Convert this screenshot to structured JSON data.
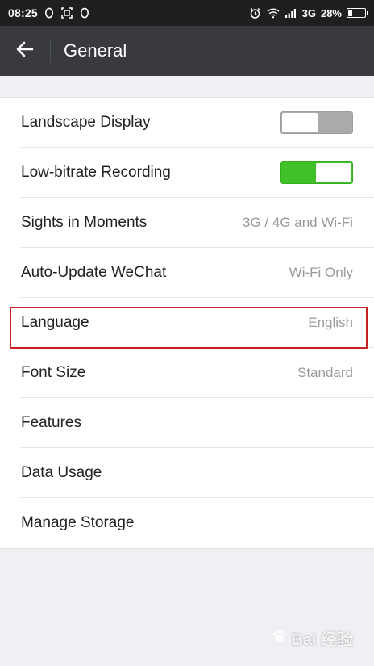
{
  "status_bar": {
    "time": "08:25",
    "network": "3G",
    "battery": "28%",
    "battery_level": 0.28,
    "left_icons": [
      "qq-penguin-icon",
      "screenshot-icon",
      "qq-penguin-icon"
    ],
    "right_icons": [
      "alarm-icon",
      "wifi-icon",
      "signal-icon"
    ]
  },
  "app_bar": {
    "title": "General",
    "back_icon": "back-arrow-icon"
  },
  "settings": {
    "items": [
      {
        "label": "Landscape Display",
        "type": "toggle",
        "on": false
      },
      {
        "label": "Low-bitrate Recording",
        "type": "toggle",
        "on": true
      },
      {
        "label": "Sights in Moments",
        "value": "3G / 4G and Wi-Fi"
      },
      {
        "label": "Auto-Update WeChat",
        "value": "Wi-Fi Only"
      },
      {
        "label": "Language",
        "value": "English",
        "highlighted": true
      },
      {
        "label": "Font Size",
        "value": "Standard"
      },
      {
        "label": "Features"
      },
      {
        "label": "Data Usage"
      },
      {
        "label": "Manage Storage"
      }
    ]
  },
  "watermark": {
    "text": "Bai 经验",
    "icon": "baidu-paw-icon"
  },
  "colors": {
    "status_bar_bg": "#1f1f1f",
    "app_bar_bg": "#393a3f",
    "page_bg": "#efeff4",
    "toggle_on": "#40c12a",
    "toggle_off": "#a9abaa",
    "highlight_border": "#c81e24"
  }
}
